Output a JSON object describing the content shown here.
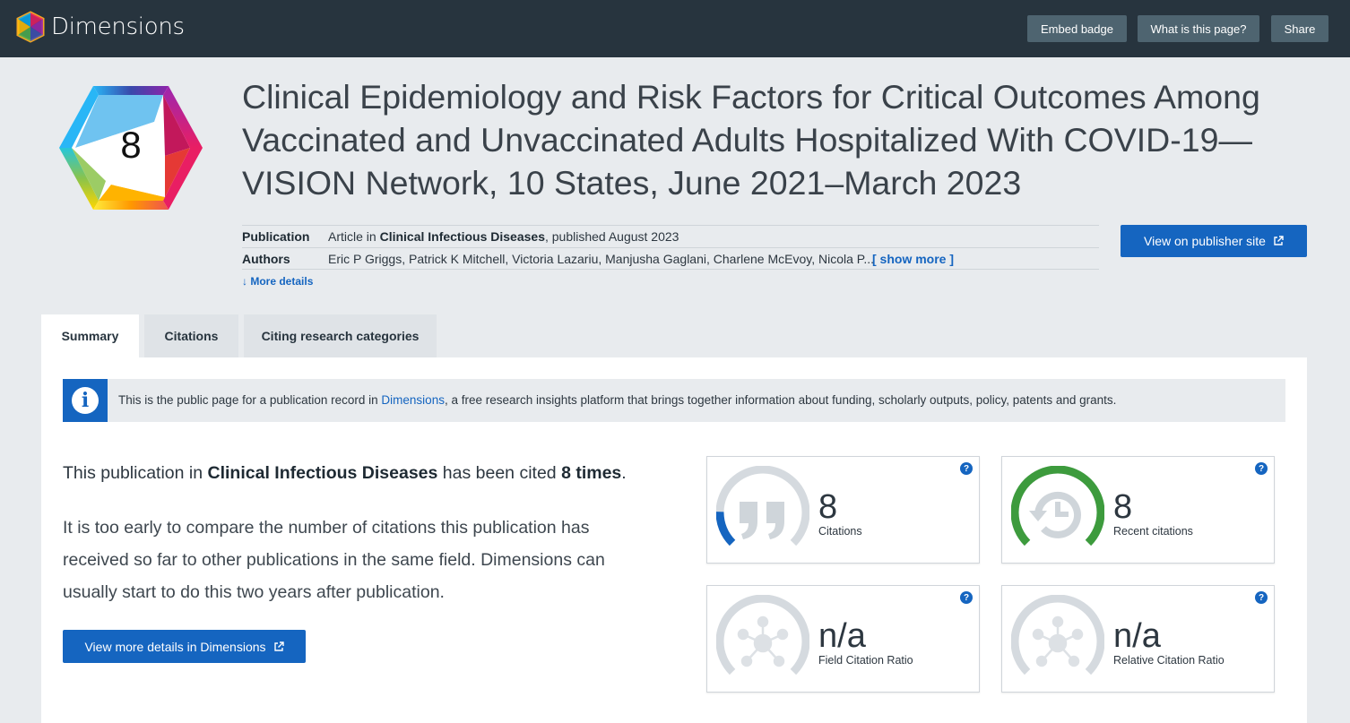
{
  "app": {
    "name": "Dimensions"
  },
  "header_buttons": {
    "embed": "Embed badge",
    "what": "What is this page?",
    "share": "Share"
  },
  "badge": {
    "number": "8"
  },
  "publication": {
    "title": "Clinical Epidemiology and Risk Factors for Critical Outcomes Among Vaccinated and Unvaccinated Adults Hospitalized With COVID-19—VISION Network, 10 States, June 2021–March 2023",
    "publication_label": "Publication",
    "publication_prefix": "Article in ",
    "journal": "Clinical Infectious Diseases",
    "publication_suffix": ", published August 2023",
    "authors_label": "Authors",
    "authors": "Eric P Griggs, Patrick K Mitchell, Victoria Lazariu, Manjusha Gaglani, Charlene McEvoy, Nicola P...",
    "show_more": "[ show more ]",
    "more_details": "More details",
    "publisher_button": "View on publisher site"
  },
  "tabs": [
    {
      "label": "Summary",
      "active": true
    },
    {
      "label": "Citations",
      "active": false
    },
    {
      "label": "Citing research categories",
      "active": false
    }
  ],
  "info": {
    "prefix": "This is the public page for a publication record in ",
    "link": "Dimensions",
    "suffix": ", a free research insights platform that brings together information about funding, scholarly outputs, policy, patents and grants."
  },
  "summary": {
    "cited_prefix": "This publication in ",
    "cited_journal": "Clinical Infectious Diseases",
    "cited_middle": " has been cited ",
    "cited_count": "8 times",
    "cited_end": ".",
    "early_text": "It is too early to compare the number of citations this publication has received so far to other publications in the same field. Dimensions can usually start to do this two years after publication.",
    "details_button": "View more details in Dimensions"
  },
  "metrics": [
    {
      "value": "8",
      "label": "Citations",
      "icon": "quote-icon",
      "gauge_fraction": 0.17,
      "gauge_color": "#1565c0"
    },
    {
      "value": "8",
      "label": "Recent citations",
      "icon": "history-icon",
      "gauge_fraction": 1.0,
      "gauge_color": "#3d9b3d"
    },
    {
      "value": "n/a",
      "label": "Field Citation Ratio",
      "icon": "network-icon",
      "gauge_fraction": 0,
      "gauge_color": "#1565c0"
    },
    {
      "value": "n/a",
      "label": "Relative Citation Ratio",
      "icon": "network-icon",
      "gauge_fraction": 0,
      "gauge_color": "#1565c0"
    }
  ],
  "help_glyph": "?"
}
